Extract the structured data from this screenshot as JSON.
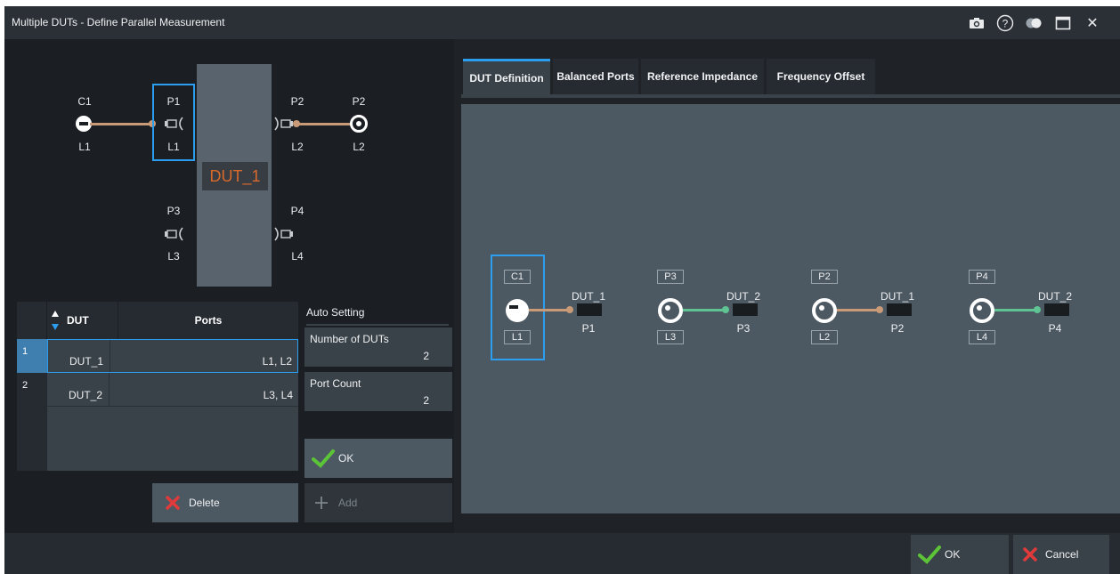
{
  "window": {
    "title": "Multiple DUTs - Define Parallel Measurement",
    "icons": [
      "camera-icon",
      "help-icon",
      "toggle-icon",
      "maximize-icon",
      "close-icon"
    ],
    "close_glyph": "✕",
    "help_glyph": "?"
  },
  "schematic": {
    "dut_name": "DUT_1",
    "c1_top": "C1",
    "c1_bottom": "L1",
    "p1_top": "P1",
    "p1_bottom": "L1",
    "p2_top": "P2",
    "p2_bottom": "L2",
    "p2r_top": "P2",
    "p2r_bottom": "L2",
    "p3_top": "P3",
    "p3_bottom": "L3",
    "p4_top": "P4",
    "p4_bottom": "L4"
  },
  "table": {
    "col_dut": "DUT",
    "col_ports": "Ports",
    "rows": [
      {
        "num": "1",
        "dut": "DUT_1",
        "ports": "L1, L2"
      },
      {
        "num": "2",
        "dut": "DUT_2",
        "ports": "L3, L4"
      }
    ]
  },
  "auto_setting": {
    "heading": "Auto Setting",
    "num_duts_label": "Number of DUTs",
    "num_duts_value": "2",
    "port_count_label": "Port Count",
    "port_count_value": "2"
  },
  "buttons": {
    "ok": "OK",
    "delete": "Delete",
    "add": "Add",
    "footer_ok": "OK",
    "footer_cancel": "Cancel"
  },
  "tabs": [
    "DUT Definition",
    "Balanced Ports",
    "Reference Impedance",
    "Frequency Offset"
  ],
  "diagram": {
    "groups": [
      {
        "top": "C1",
        "bottom": "L1",
        "dut": "DUT_1",
        "port": "P1",
        "symbol": "minus",
        "line": "orange"
      },
      {
        "top": "P3",
        "bottom": "L3",
        "dut": "DUT_2",
        "port": "P3",
        "symbol": "ring",
        "line": "green"
      },
      {
        "top": "P2",
        "bottom": "L2",
        "dut": "DUT_1",
        "port": "P2",
        "symbol": "ring",
        "line": "orange"
      },
      {
        "top": "P4",
        "bottom": "L4",
        "dut": "DUT_2",
        "port": "P4",
        "symbol": "ring",
        "line": "green"
      }
    ]
  },
  "colors": {
    "accent_blue": "#2b9ef0",
    "orange_line": "#c89a78",
    "green_line": "#5fc393",
    "dut_text": "#d9692b",
    "check_green": "#5cc437",
    "cross_red": "#e03a3a"
  }
}
